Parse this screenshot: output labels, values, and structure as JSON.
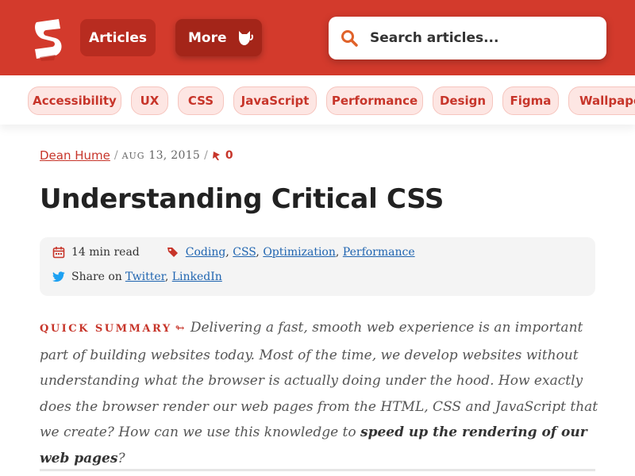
{
  "header": {
    "nav_articles": "Articles",
    "nav_more": "More",
    "search_placeholder": "Search articles...",
    "brand_color": "#d33a2c",
    "icons": [
      "smashing-logo-icon",
      "cat-icon",
      "search-icon"
    ]
  },
  "tags": [
    "Accessibility",
    "UX",
    "CSS",
    "JavaScript",
    "Performance",
    "Design",
    "Figma",
    "Wallpapers"
  ],
  "article": {
    "author": "Dean Hume",
    "sep1": "/",
    "date_month": "Aug",
    "date_rest": "13, 2015",
    "sep2": "/",
    "comments": "0",
    "title": "Understanding Critical CSS",
    "read_time": "14 min read",
    "categories": [
      "Coding",
      "CSS",
      "Optimization",
      "Performance"
    ],
    "share_label": "Share on",
    "share_links": [
      "Twitter",
      "LinkedIn"
    ],
    "summary_label": "Quick summary",
    "summary_arrow": "↬",
    "summary_text": "Delivering a fast, smooth web experience is an important part of building websites today. Most of the time, we develop websites without understanding what the browser is actually doing under the hood. How exactly does the browser render our web pages from the HTML, CSS and JavaScript that we create? How can we use this knowledge to ",
    "summary_bold": "speed up the rendering of our web pages",
    "summary_end": "?"
  }
}
